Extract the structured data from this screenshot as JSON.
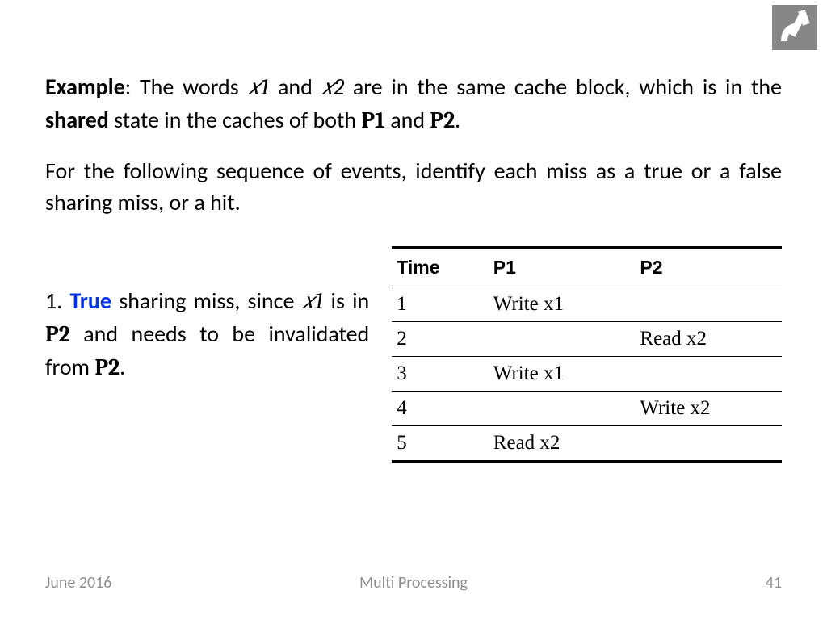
{
  "logo_alt": "institution-logo",
  "intro": {
    "label": "Example",
    "pre": ": The words ",
    "x1": "𝑥1",
    "mid1": " and ",
    "x2": "𝑥2",
    "mid2": " are in the same cache block, which is in the ",
    "shared": "shared",
    "mid3": " state in the caches of both ",
    "p1": "P1",
    "and": " and ",
    "p2": "P2",
    "end": "."
  },
  "instruction": "For the following sequence of events, identify each miss as a true or a false sharing miss, or a hit.",
  "note": {
    "num": "1. ",
    "true_word": "True",
    "part1": " sharing miss, since ",
    "x1": "𝑥1",
    "part2": " is in ",
    "p2a": "P2",
    "part3": " and needs to be invalidated from ",
    "p2b": "P2",
    "end": "."
  },
  "table": {
    "headers": {
      "time": "Time",
      "p1": "P1",
      "p2": "P2"
    },
    "rows": [
      {
        "time": "1",
        "p1": "Write x1",
        "p2": ""
      },
      {
        "time": "2",
        "p1": "",
        "p2": "Read x2"
      },
      {
        "time": "3",
        "p1": "Write x1",
        "p2": ""
      },
      {
        "time": "4",
        "p1": "",
        "p2": "Write x2"
      },
      {
        "time": "5",
        "p1": "Read x2",
        "p2": ""
      }
    ]
  },
  "footer": {
    "date": "June 2016",
    "title": "Multi Processing",
    "page": "41"
  }
}
